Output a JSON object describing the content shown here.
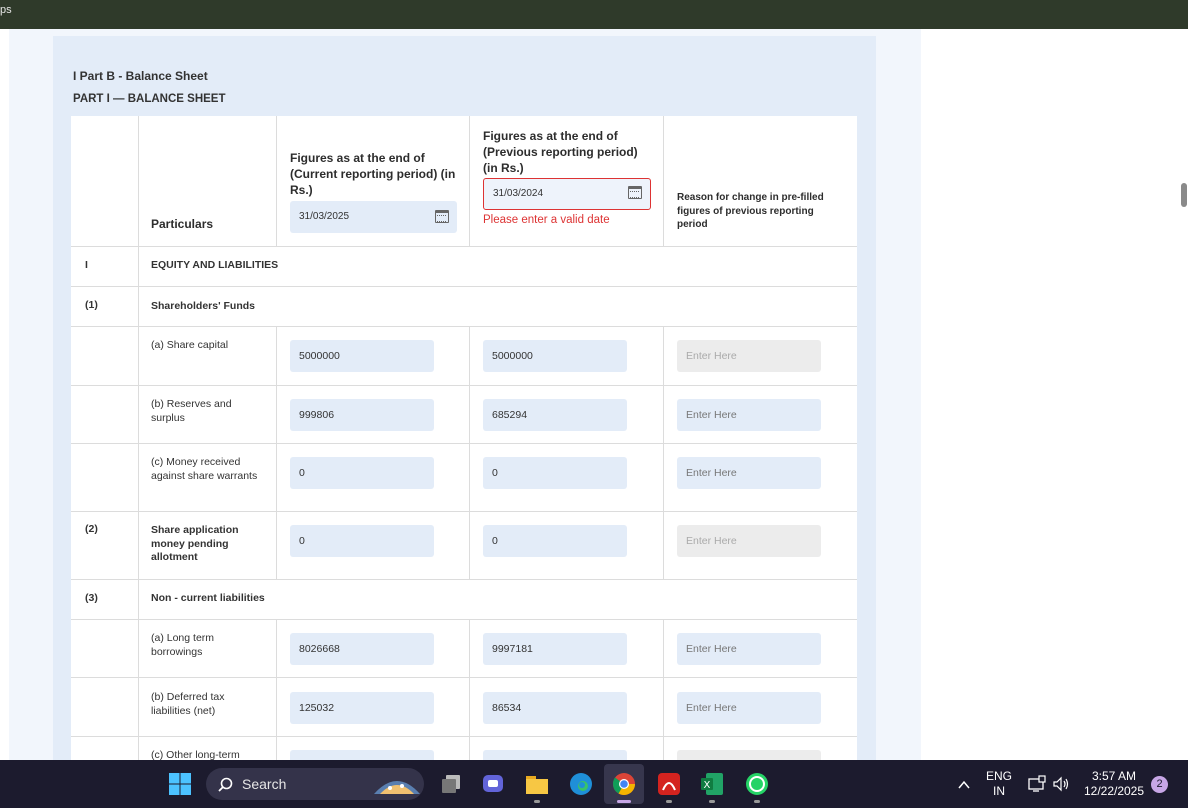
{
  "topbar": {
    "text": "ps"
  },
  "section": {
    "title": "I Part B - Balance Sheet",
    "subtitle": "PART I — BALANCE SHEET"
  },
  "table": {
    "headers": {
      "particulars": "Particulars",
      "current": "Figures as at the end of (Current reporting period) (in Rs.)",
      "previous": "Figures as at the end of (Previous reporting period) (in Rs.)",
      "reason": "Reason for change in pre-filled figures of previous reporting period"
    },
    "current_date": "31/03/2025",
    "previous_date": "31/03/2024",
    "previous_date_error": "Please enter a valid date",
    "rows": [
      {
        "num": "I",
        "label": "EQUITY AND LIABILITIES"
      },
      {
        "num": "(1)",
        "label": "Shareholders' Funds"
      },
      {
        "num": "",
        "label": "(a) Share capital",
        "current": "5000000",
        "previous": "5000000",
        "reason": "Enter Here"
      },
      {
        "num": "",
        "label": "(b) Reserves and surplus",
        "current": "999806",
        "previous": "685294",
        "reason": "Enter Here"
      },
      {
        "num": "",
        "label": "(c) Money received against share warrants",
        "current": "0",
        "previous": "0",
        "reason": "Enter Here"
      },
      {
        "num": "(2)",
        "label": "Share application money pending allotment",
        "current": "0",
        "previous": "0",
        "reason": "Enter Here"
      },
      {
        "num": "(3)",
        "label": "Non - current liabilities"
      },
      {
        "num": "",
        "label": "(a) Long term borrowings",
        "current": "8026668",
        "previous": "9997181",
        "reason": "Enter Here"
      },
      {
        "num": "",
        "label": "(b) Deferred tax liabilities (net)",
        "current": "125032",
        "previous": "86534",
        "reason": "Enter Here"
      },
      {
        "num": "",
        "label": "(c) Other long-term"
      }
    ]
  },
  "taskbar": {
    "search_label": "Search",
    "lang": "ENG",
    "region": "IN",
    "time": "3:57 AM",
    "date": "12/22/2025",
    "notification_count": "2"
  }
}
